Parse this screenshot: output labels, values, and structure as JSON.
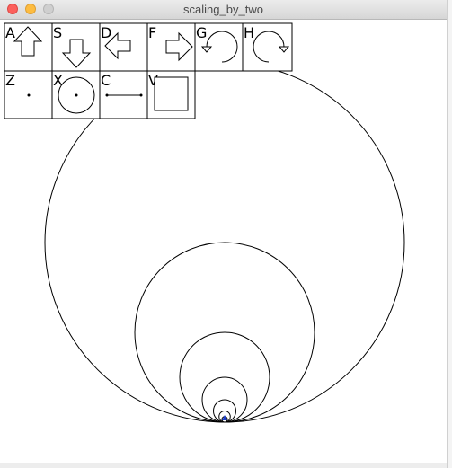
{
  "window": {
    "title": "scaling_by_two"
  },
  "toolbar": {
    "row1": [
      {
        "key": "A",
        "icon": "arrow-up-icon"
      },
      {
        "key": "S",
        "icon": "arrow-down-icon"
      },
      {
        "key": "D",
        "icon": "arrow-left-icon"
      },
      {
        "key": "F",
        "icon": "arrow-right-icon"
      },
      {
        "key": "G",
        "icon": "rotate-ccw-icon"
      },
      {
        "key": "H",
        "icon": "rotate-cw-icon"
      }
    ],
    "row2": [
      {
        "key": "Z",
        "icon": "point-icon"
      },
      {
        "key": "X",
        "icon": "circle-icon"
      },
      {
        "key": "C",
        "icon": "segment-icon"
      },
      {
        "key": "V",
        "icon": "square-icon"
      }
    ]
  },
  "drawing": {
    "shape": "circles scaled by two, tangent at bottom",
    "stroke_color": "#000000",
    "marker_color": "#1a3ccc"
  }
}
